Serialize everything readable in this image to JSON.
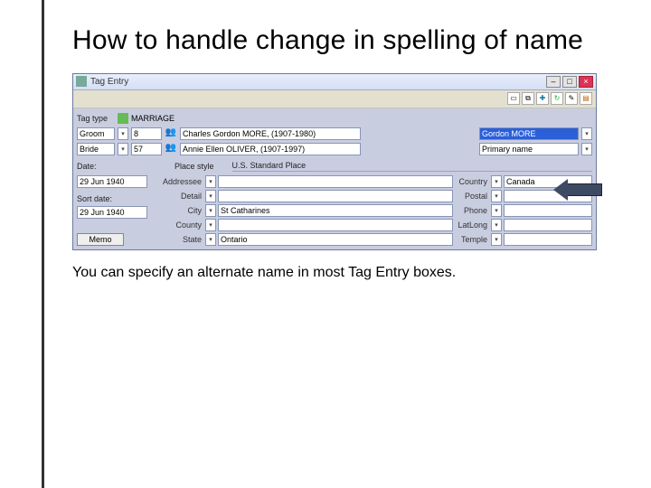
{
  "title": "How to handle change in spelling of name",
  "caption": "You can specify an alternate name in most Tag Entry boxes.",
  "dialog": {
    "title": "Tag Entry",
    "tagtype_label": "Tag type",
    "tagtype_value": "MARRIAGE",
    "principals": [
      {
        "role": "Groom",
        "id": "8",
        "name": "Charles Gordon MORE, (1907-1980)"
      },
      {
        "role": "Bride",
        "id": "57",
        "name": "Annie Ellen OLIVER, (1907-1997)"
      }
    ],
    "name_variant": {
      "selected": "Gordon MORE",
      "type": "Primary name"
    },
    "date_label": "Date:",
    "date_value": "29 Jun 1940",
    "sortdate_label": "Sort date:",
    "sortdate_value": "29 Jun 1940",
    "placestyle_label": "Place style",
    "placeset_label": "U.S. Standard Place",
    "mid": {
      "addressee_label": "Addressee",
      "addressee": "",
      "detail_label": "Detail",
      "detail": "",
      "city_label": "City",
      "city": "St Catharines",
      "county_label": "County",
      "county": "",
      "state_label": "State",
      "state": "Ontario"
    },
    "right": {
      "country_label": "Country",
      "country": "Canada",
      "postal_label": "Postal",
      "postal": "",
      "phone_label": "Phone",
      "phone": "",
      "latlong_label": "LatLong",
      "latlong": "",
      "temple_label": "Temple",
      "temple": ""
    },
    "memo_label": "Memo",
    "toolbar_icons": [
      "book-icon",
      "copy-icon",
      "plus-icon",
      "refresh-icon",
      "gear-icon",
      "chart-icon"
    ],
    "window_buttons": {
      "min": "–",
      "max": "□",
      "close": "×"
    }
  }
}
